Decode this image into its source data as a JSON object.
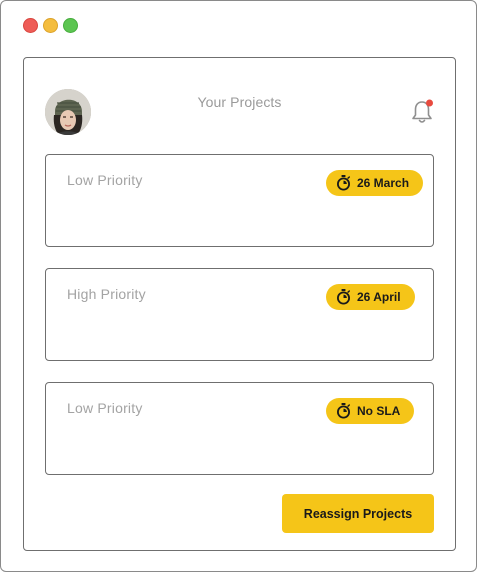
{
  "header": {
    "title": "Your Projects",
    "avatar_icon": "user-avatar",
    "notification_icon": "bell-icon",
    "notification_dot_color": "#e84a3e"
  },
  "projects": [
    {
      "priority": "Low Priority",
      "sla": "26 March",
      "sla_icon": "stopwatch-icon"
    },
    {
      "priority": "High Priority",
      "sla": "26 April",
      "sla_icon": "stopwatch-icon"
    },
    {
      "priority": "Low Priority",
      "sla": "No SLA",
      "sla_icon": "stopwatch-icon"
    }
  ],
  "actions": {
    "reassign_label": "Reassign Projects"
  },
  "colors": {
    "accent": "#f5c518",
    "muted_text": "#a3a3a3",
    "border": "#6f6f6f"
  }
}
